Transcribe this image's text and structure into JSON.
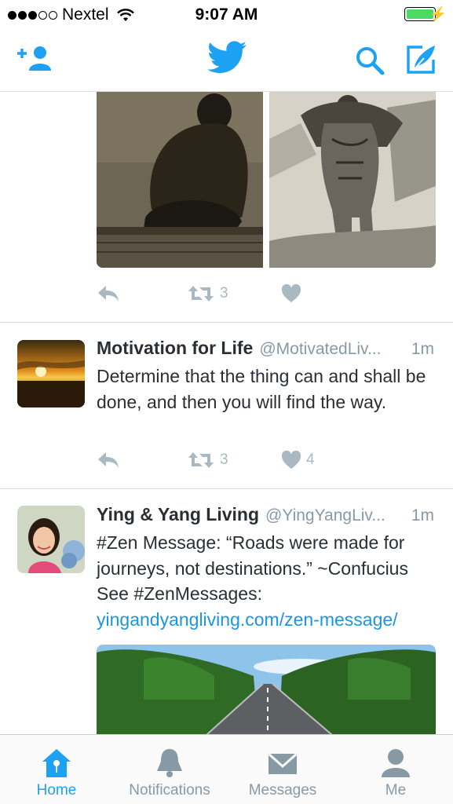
{
  "status_bar": {
    "carrier": "Nextel",
    "time": "9:07 AM"
  },
  "colors": {
    "brand": "#1da1f2",
    "link": "#1b95e0",
    "muted": "#8899a6",
    "battery": "#4cd964"
  },
  "nav": {
    "icons": [
      "add-user-icon",
      "twitter-bird-icon",
      "search-icon",
      "compose-icon"
    ]
  },
  "tweets": [
    {
      "retweets": "3",
      "likes": ""
    },
    {
      "name": "Motivation for Life",
      "handle": "@MotivatedLiv...",
      "time": "1m",
      "text": "Determine that the thing can and shall be done, and then you will find the way.",
      "retweets": "3",
      "likes": "4"
    },
    {
      "name": "Ying & Yang Living",
      "handle": "@YingYangLiv...",
      "time": "1m",
      "text": "#Zen Message: “Roads were made for journeys, not destinations.” ~Confucius See #ZenMessages:",
      "link": "yingandyangliving.com/zen-message/"
    }
  ],
  "tabbar": {
    "tabs": [
      {
        "label": "Home",
        "active": true
      },
      {
        "label": "Notifications"
      },
      {
        "label": "Messages"
      },
      {
        "label": "Me"
      }
    ]
  }
}
